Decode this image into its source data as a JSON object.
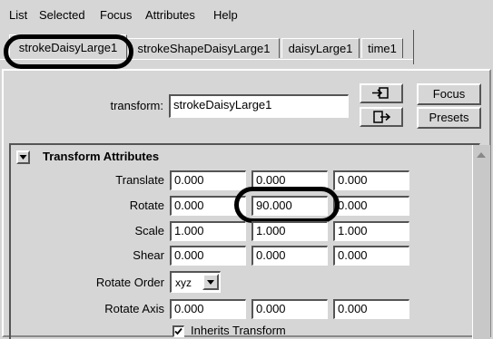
{
  "menu": [
    "List",
    "Selected",
    "Focus",
    "Attributes",
    "Help"
  ],
  "tabs": [
    "strokeDaisyLarge1",
    "strokeShapeDaisyLarge1",
    "daisyLarge1",
    "time1"
  ],
  "node": {
    "type_label": "transform:",
    "name_value": "strokeDaisyLarge1",
    "focus_label": "Focus",
    "presets_label": "Presets",
    "load_icon": "load-attributes-icon",
    "copy_icon": "copy-tab-icon"
  },
  "section": {
    "title": "Transform Attributes",
    "collapse_icon": "triangle-down-icon",
    "rows": [
      {
        "label": "Translate",
        "values": [
          "0.000",
          "0.000",
          "0.000"
        ]
      },
      {
        "label": "Rotate",
        "values": [
          "0.000",
          "90.000",
          "0.000"
        ]
      },
      {
        "label": "Scale",
        "values": [
          "1.000",
          "1.000",
          "1.000"
        ]
      },
      {
        "label": "Shear",
        "values": [
          "0.000",
          "0.000",
          "0.000"
        ]
      }
    ],
    "rotate_order_label": "Rotate Order",
    "rotate_order_value": "xyz",
    "rotate_axis_label": "Rotate Axis",
    "rotate_axis_values": [
      "0.000",
      "0.000",
      "0.000"
    ],
    "inherits_label": "Inherits Transform",
    "inherits_checked": true
  }
}
